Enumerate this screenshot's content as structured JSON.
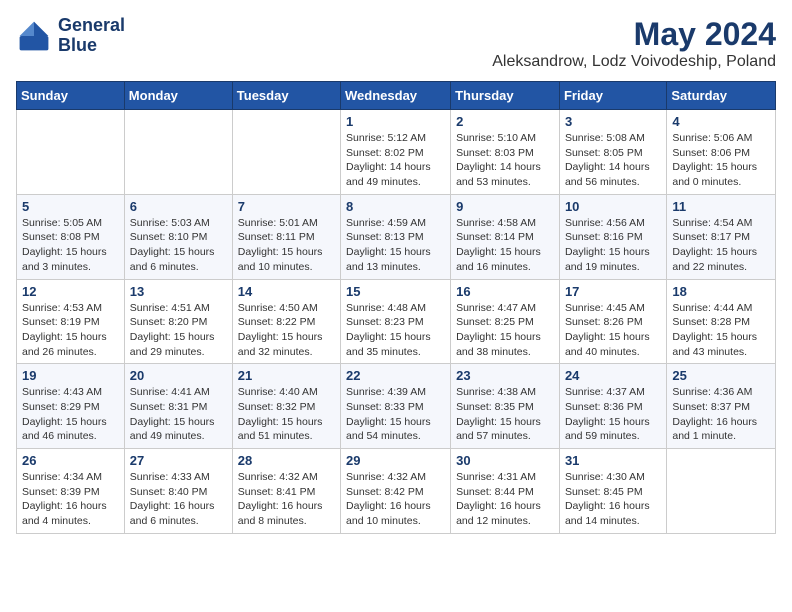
{
  "header": {
    "logo_line1": "General",
    "logo_line2": "Blue",
    "title": "May 2024",
    "subtitle": "Aleksandrow, Lodz Voivodeship, Poland"
  },
  "weekdays": [
    "Sunday",
    "Monday",
    "Tuesday",
    "Wednesday",
    "Thursday",
    "Friday",
    "Saturday"
  ],
  "weeks": [
    [
      {
        "day": "",
        "info": ""
      },
      {
        "day": "",
        "info": ""
      },
      {
        "day": "",
        "info": ""
      },
      {
        "day": "1",
        "info": "Sunrise: 5:12 AM\nSunset: 8:02 PM\nDaylight: 14 hours\nand 49 minutes."
      },
      {
        "day": "2",
        "info": "Sunrise: 5:10 AM\nSunset: 8:03 PM\nDaylight: 14 hours\nand 53 minutes."
      },
      {
        "day": "3",
        "info": "Sunrise: 5:08 AM\nSunset: 8:05 PM\nDaylight: 14 hours\nand 56 minutes."
      },
      {
        "day": "4",
        "info": "Sunrise: 5:06 AM\nSunset: 8:06 PM\nDaylight: 15 hours\nand 0 minutes."
      }
    ],
    [
      {
        "day": "5",
        "info": "Sunrise: 5:05 AM\nSunset: 8:08 PM\nDaylight: 15 hours\nand 3 minutes."
      },
      {
        "day": "6",
        "info": "Sunrise: 5:03 AM\nSunset: 8:10 PM\nDaylight: 15 hours\nand 6 minutes."
      },
      {
        "day": "7",
        "info": "Sunrise: 5:01 AM\nSunset: 8:11 PM\nDaylight: 15 hours\nand 10 minutes."
      },
      {
        "day": "8",
        "info": "Sunrise: 4:59 AM\nSunset: 8:13 PM\nDaylight: 15 hours\nand 13 minutes."
      },
      {
        "day": "9",
        "info": "Sunrise: 4:58 AM\nSunset: 8:14 PM\nDaylight: 15 hours\nand 16 minutes."
      },
      {
        "day": "10",
        "info": "Sunrise: 4:56 AM\nSunset: 8:16 PM\nDaylight: 15 hours\nand 19 minutes."
      },
      {
        "day": "11",
        "info": "Sunrise: 4:54 AM\nSunset: 8:17 PM\nDaylight: 15 hours\nand 22 minutes."
      }
    ],
    [
      {
        "day": "12",
        "info": "Sunrise: 4:53 AM\nSunset: 8:19 PM\nDaylight: 15 hours\nand 26 minutes."
      },
      {
        "day": "13",
        "info": "Sunrise: 4:51 AM\nSunset: 8:20 PM\nDaylight: 15 hours\nand 29 minutes."
      },
      {
        "day": "14",
        "info": "Sunrise: 4:50 AM\nSunset: 8:22 PM\nDaylight: 15 hours\nand 32 minutes."
      },
      {
        "day": "15",
        "info": "Sunrise: 4:48 AM\nSunset: 8:23 PM\nDaylight: 15 hours\nand 35 minutes."
      },
      {
        "day": "16",
        "info": "Sunrise: 4:47 AM\nSunset: 8:25 PM\nDaylight: 15 hours\nand 38 minutes."
      },
      {
        "day": "17",
        "info": "Sunrise: 4:45 AM\nSunset: 8:26 PM\nDaylight: 15 hours\nand 40 minutes."
      },
      {
        "day": "18",
        "info": "Sunrise: 4:44 AM\nSunset: 8:28 PM\nDaylight: 15 hours\nand 43 minutes."
      }
    ],
    [
      {
        "day": "19",
        "info": "Sunrise: 4:43 AM\nSunset: 8:29 PM\nDaylight: 15 hours\nand 46 minutes."
      },
      {
        "day": "20",
        "info": "Sunrise: 4:41 AM\nSunset: 8:31 PM\nDaylight: 15 hours\nand 49 minutes."
      },
      {
        "day": "21",
        "info": "Sunrise: 4:40 AM\nSunset: 8:32 PM\nDaylight: 15 hours\nand 51 minutes."
      },
      {
        "day": "22",
        "info": "Sunrise: 4:39 AM\nSunset: 8:33 PM\nDaylight: 15 hours\nand 54 minutes."
      },
      {
        "day": "23",
        "info": "Sunrise: 4:38 AM\nSunset: 8:35 PM\nDaylight: 15 hours\nand 57 minutes."
      },
      {
        "day": "24",
        "info": "Sunrise: 4:37 AM\nSunset: 8:36 PM\nDaylight: 15 hours\nand 59 minutes."
      },
      {
        "day": "25",
        "info": "Sunrise: 4:36 AM\nSunset: 8:37 PM\nDaylight: 16 hours\nand 1 minute."
      }
    ],
    [
      {
        "day": "26",
        "info": "Sunrise: 4:34 AM\nSunset: 8:39 PM\nDaylight: 16 hours\nand 4 minutes."
      },
      {
        "day": "27",
        "info": "Sunrise: 4:33 AM\nSunset: 8:40 PM\nDaylight: 16 hours\nand 6 minutes."
      },
      {
        "day": "28",
        "info": "Sunrise: 4:32 AM\nSunset: 8:41 PM\nDaylight: 16 hours\nand 8 minutes."
      },
      {
        "day": "29",
        "info": "Sunrise: 4:32 AM\nSunset: 8:42 PM\nDaylight: 16 hours\nand 10 minutes."
      },
      {
        "day": "30",
        "info": "Sunrise: 4:31 AM\nSunset: 8:44 PM\nDaylight: 16 hours\nand 12 minutes."
      },
      {
        "day": "31",
        "info": "Sunrise: 4:30 AM\nSunset: 8:45 PM\nDaylight: 16 hours\nand 14 minutes."
      },
      {
        "day": "",
        "info": ""
      }
    ]
  ]
}
